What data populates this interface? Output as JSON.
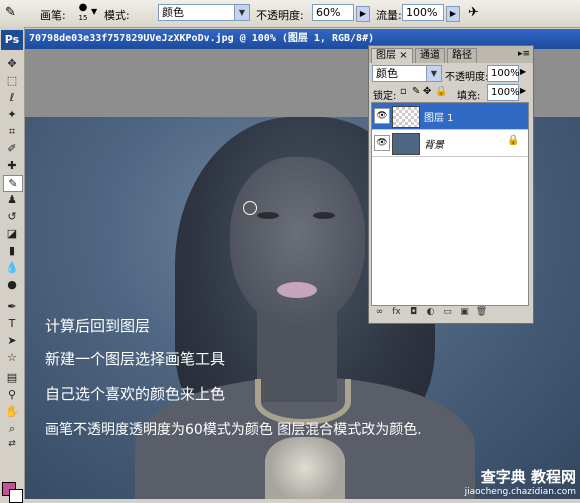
{
  "options_bar": {
    "brush_label": "画笔:",
    "brush_size": "15",
    "mode_label": "模式:",
    "mode_value": "颜色",
    "opacity_label": "不透明度:",
    "opacity_value": "60%",
    "flow_label": "流量:",
    "flow_value": "100%"
  },
  "app_logo": "Ps",
  "document": {
    "title": "70798de03e33f757829UVeJzXKPoDv.jpg @ 100% (图层 1, RGB/8#)"
  },
  "layers_panel": {
    "tabs": [
      "图层",
      "通道",
      "路径"
    ],
    "close_glyph": "×",
    "blend_mode": "颜色",
    "opacity_label": "不透明度:",
    "opacity_value": "100%",
    "lock_label": "锁定:",
    "fill_label": "填充:",
    "fill_value": "100%",
    "layers": [
      {
        "name": "图层 1",
        "selected": true
      },
      {
        "name": "背景",
        "selected": false,
        "locked": true
      }
    ],
    "bottom_icons": [
      "link-icon",
      "fx-icon",
      "mask-icon",
      "adjustment-icon",
      "folder-icon",
      "new-layer-icon",
      "trash-icon"
    ]
  },
  "overlay_text": [
    "计算后回到图层",
    "新建一个图层选择画笔工具",
    "自己选个喜欢的颜色来上色",
    "画笔不透明度透明度为60模式为颜色  图层混合模式改为颜色."
  ],
  "watermark": {
    "line1": "查字典 教程网",
    "line2": "jiaocheng.chazidian.com"
  },
  "colors": {
    "foreground": "#c84f9c",
    "background": "#ffffff",
    "selection": "#316ac5",
    "titlebar": "#1c4b9e"
  }
}
